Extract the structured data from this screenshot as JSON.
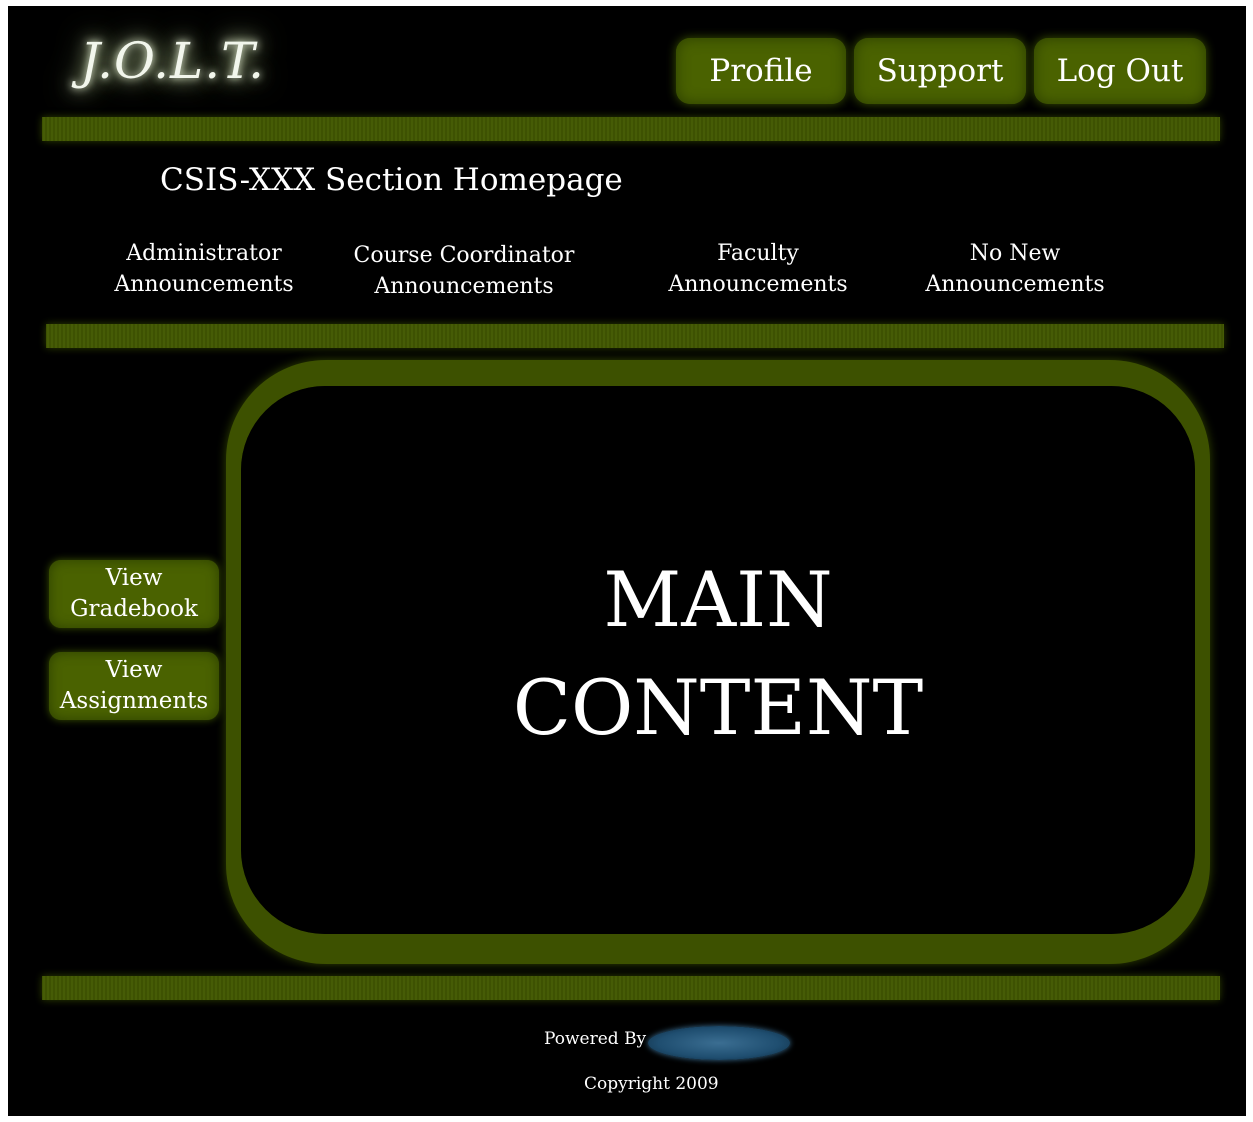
{
  "logo": {
    "text": "J.O.L.T."
  },
  "nav": {
    "profile": "Profile",
    "support": "Support",
    "logout": "Log Out"
  },
  "section": {
    "title": "CSIS-XXX Section Homepage"
  },
  "announcements": [
    {
      "line1": "Administrator",
      "line2": "Announcements"
    },
    {
      "line1": "Course Coordinator",
      "line2": "Announcements"
    },
    {
      "line1": "Faculty",
      "line2": "Announcements"
    },
    {
      "line1": "No New",
      "line2": "Announcements"
    }
  ],
  "sidebar": {
    "gradebook": {
      "line1": "View",
      "line2": "Gradebook"
    },
    "assignments": {
      "line1": "View",
      "line2": "Assignments"
    }
  },
  "main": {
    "line1": "MAIN",
    "line2": "CONTENT"
  },
  "footer": {
    "powered_by": "Powered By",
    "copyright": "Copyright 2009"
  },
  "colors": {
    "background": "#000000",
    "accent_green": "#4a6200",
    "band_green": "#3d5100",
    "text": "#ffffff"
  }
}
